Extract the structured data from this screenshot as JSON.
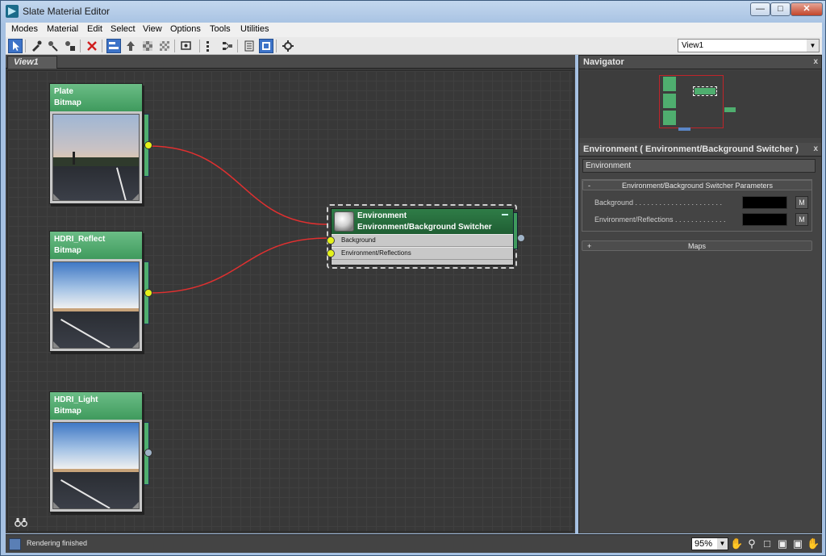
{
  "window": {
    "title": "Slate Material Editor"
  },
  "menu": [
    "Modes",
    "Material",
    "Edit",
    "Select",
    "View",
    "Options",
    "Tools",
    "Utilities"
  ],
  "toolbar": {
    "view_select": "View1",
    "tools": [
      "select-tool-icon",
      "pick-material-icon",
      "put-to-scene-icon",
      "assign-to-selection-icon",
      "delete-icon",
      "move-children-icon",
      "hide-unused-slots-icon",
      "show-map-icon",
      "show-shaded-icon",
      "show-end-result-icon",
      "lay-out-all-icon",
      "lay-out-children-icon",
      "material-parameter-editor-icon",
      "select-by-material-icon",
      "options-icon"
    ]
  },
  "view": {
    "tab": "View1"
  },
  "nodes": [
    {
      "title": "Plate",
      "subtitle": "Bitmap",
      "thumb": "plate"
    },
    {
      "title": "HDRI_Reflect",
      "subtitle": "Bitmap",
      "thumb": "reflect"
    },
    {
      "title": "HDRI_Light",
      "subtitle": "Bitmap",
      "thumb": "light"
    }
  ],
  "env_node": {
    "title": "Environment",
    "subtitle": "Environment/Background Switcher",
    "slots": [
      "Background",
      "Environment/Reflections"
    ]
  },
  "colors": {
    "node_green": "#4fae6f",
    "port_yellow": "#e4f21a",
    "wire_red": "#e03030",
    "selection_red": "#c0242a"
  },
  "navigator": {
    "title": "Navigator",
    "close": "x"
  },
  "properties": {
    "title": "Environment  ( Environment/Background Switcher )",
    "close": "x",
    "name": "Environment",
    "rollout_title": "Environment/Background Switcher Parameters",
    "rollout_sign": "-",
    "params": [
      {
        "label": "Background . . . . . . . . . . . . . . . . . . . . . .",
        "button": "M"
      },
      {
        "label": "Environment/Reflections . . . . . . . . . . . . .",
        "button": "M"
      }
    ],
    "maps_title": "Maps",
    "maps_sign": "+"
  },
  "status": {
    "text": "Rendering finished",
    "zoom": "95%"
  }
}
